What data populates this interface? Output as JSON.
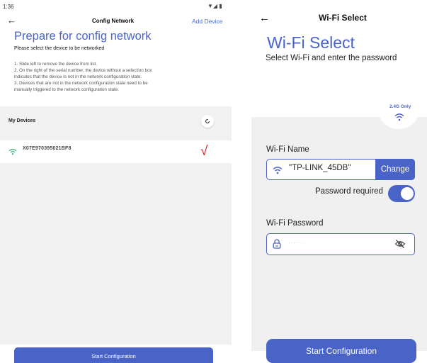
{
  "left_screen": {
    "status_time": "1:36",
    "status_icons": "▼◢ ▮",
    "back_icon": "←",
    "nav_title": "Config Network",
    "add_device": "Add Device",
    "title": "Prepare for config network",
    "subtitle": "Please select the device to be networked",
    "notes": [
      "1. Slide left to remove the device from list.",
      "2. On the right of the serial number, the device without a selection box",
      "indicates that the device is not in the network configuration state.",
      "3. Devices that are not in the network configuration state need to be",
      "manually triggered to the network configuration state."
    ],
    "devices_header": "My Devices",
    "refresh_icon": "refresh-icon",
    "devices": [
      {
        "serial": "X07E970395021BF8",
        "check": "√",
        "signal_icon": "wifi-icon"
      }
    ],
    "start_button": "Start Configuration"
  },
  "right_screen": {
    "back_icon": "←",
    "nav_title": "Wi-Fi Select",
    "title": "Wi-Fi Select",
    "subtitle": "Select Wi-Fi and enter the password",
    "badge": "2.4G Only",
    "wifi_name_label": "Wi-Fi Name",
    "wifi_name_value": "\"TP-LINK_45DB\"",
    "change_button": "Change",
    "password_required_label": "Password required",
    "password_required_on": true,
    "wifi_password_label": "Wi-Fi Password",
    "password_mask": "······",
    "start_button": "Start Configuration"
  },
  "colors": {
    "accent": "#4a63c7",
    "check_red": "#d81f1f",
    "panel_gray": "#f1f1f1",
    "wifi_green": "#2fb56a"
  }
}
